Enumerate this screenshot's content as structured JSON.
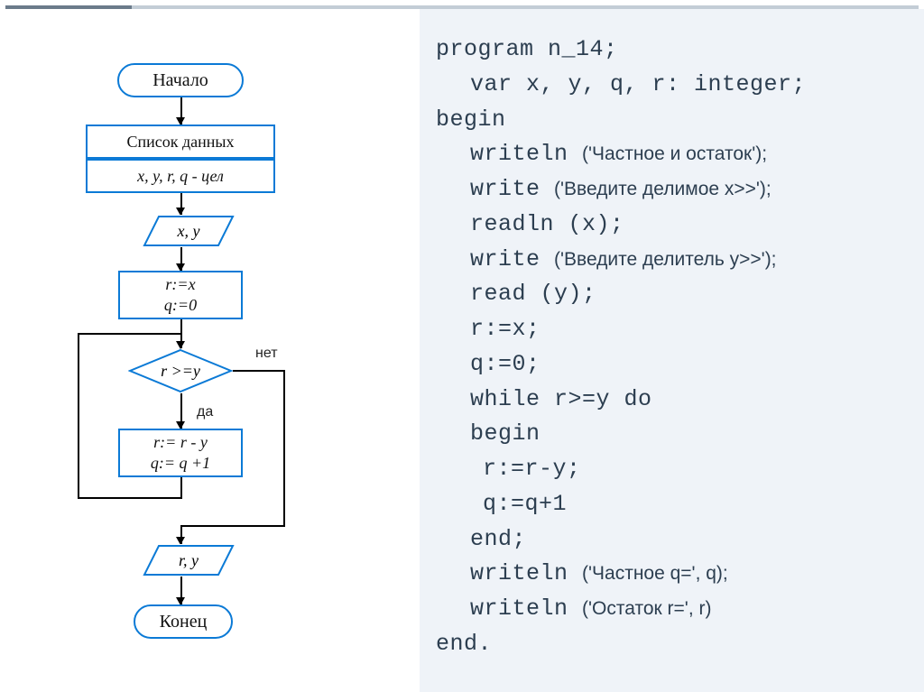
{
  "flowchart": {
    "start": "Начало",
    "data_list_header": "Список данных",
    "data_list_vars": "x, y, r, q - цел",
    "input1": "x, y",
    "process1_line1": "r:=x",
    "process1_line2": "q:=0",
    "decision": "r >=y",
    "label_no": "нет",
    "label_yes": "да",
    "process2_line1": "r:= r - y",
    "process2_line2": "q:= q +1",
    "output": "r, y",
    "end": "Конец"
  },
  "code": {
    "l1_a": "program ",
    "l1_b": "n_14;",
    "l2_a": "var ",
    "l2_b": "x, y, q, r: integer;",
    "l3": "begin",
    "l4_a": "writeln ",
    "l4_b": "('Частное и остаток');",
    "l5_a": "write  ",
    "l5_b": "('Введите делимое x>>');",
    "l6": "readln (x);",
    "l7_a": "write ",
    "l7_b": "('Введите делитель y>>');",
    "l8": "read (y);",
    "l9": "r:=x;",
    "l10": "q:=0;",
    "l11_a": "while ",
    "l11_b": "r>=y ",
    "l11_c": "do",
    "l12": "begin",
    "l13": "r:=r-y;",
    "l14": "q:=q+1",
    "l15": "end;",
    "l16_a": "writeln ",
    "l16_b": "('Частное q=', q);",
    "l17_a": "writeln ",
    "l17_b": "('Остаток r=', r)",
    "l18": "end."
  }
}
